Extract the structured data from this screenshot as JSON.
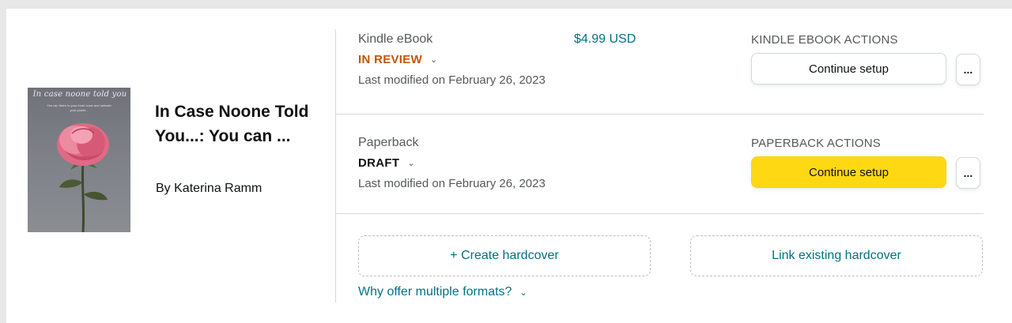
{
  "book": {
    "cover_title": "In case noone told you",
    "cover_subtitle": "You can listen to your inner voice and unleash your power...",
    "title": "In Case Noone Told You...: You can ...",
    "author": "By Katerina Ramm"
  },
  "kindle": {
    "format": "Kindle eBook",
    "status": "IN REVIEW",
    "modified": "Last modified on February 26, 2023",
    "price": "$4.99 USD",
    "actions_label": "KINDLE EBOOK ACTIONS",
    "continue_label": "Continue setup",
    "more_label": "..."
  },
  "paperback": {
    "format": "Paperback",
    "status": "DRAFT",
    "modified": "Last modified on February 26, 2023",
    "actions_label": "PAPERBACK ACTIONS",
    "continue_label": "Continue setup",
    "more_label": "..."
  },
  "hardcover": {
    "create_label": "+ Create hardcover",
    "link_label": "Link existing hardcover"
  },
  "why_link": "Why offer multiple formats?",
  "icons": {
    "status_chevron": "chevron-down-icon",
    "why_chevron": "chevron-down-icon"
  },
  "colors": {
    "in_review": "#c45500",
    "link": "#007185",
    "primary_button": "#ffd814"
  }
}
